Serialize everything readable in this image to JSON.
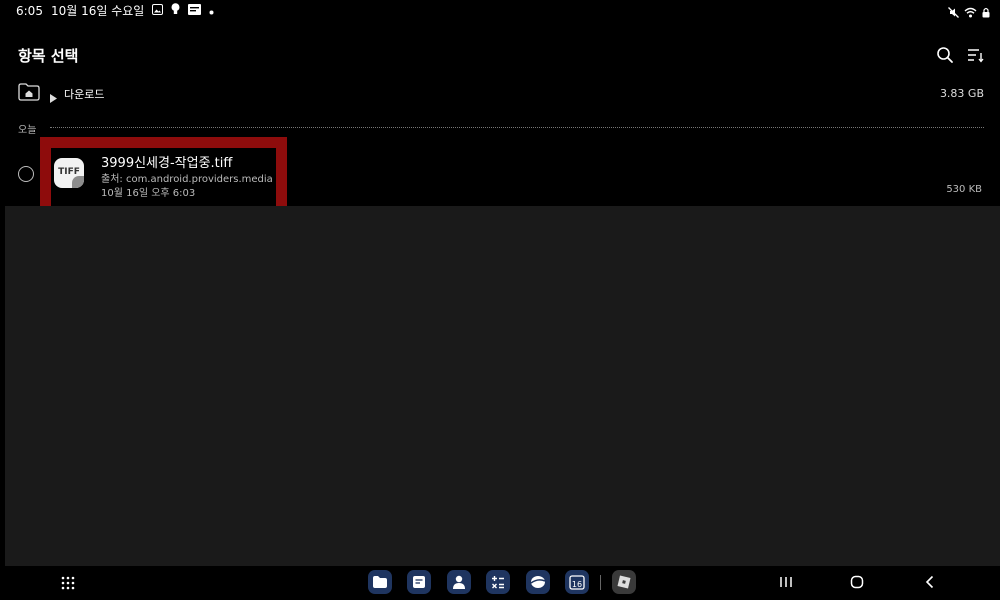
{
  "status_bar": {
    "time": "6:05",
    "date": "10월 16일 수요일",
    "icons_left": [
      "image-icon",
      "bulb-icon",
      "screenshot-icon",
      "dot-icon"
    ],
    "icons_right": [
      "mute-icon",
      "wifi-icon",
      "lock-icon"
    ]
  },
  "header": {
    "title": "항목 선택",
    "actions": [
      "search-icon",
      "sort-icon"
    ]
  },
  "breadcrumb": {
    "folder": "다운로드",
    "storage_size": "3.83 GB"
  },
  "section": {
    "label": "오늘"
  },
  "files": [
    {
      "type_label": "TIFF",
      "name": "3999신세경-작업중.tiff",
      "source": "출처: com.android.providers.media",
      "date": "10월 16일 오후 6:03",
      "size": "530 KB",
      "selected": false
    }
  ],
  "colors": {
    "background": "#000000",
    "empty_area": "#1a1a1a",
    "highlight": "#8e0c0c",
    "dock_app": "#1f3560"
  },
  "nav_bar": {
    "dock_apps": [
      "files-icon",
      "notes-icon",
      "contacts-icon",
      "calculator-icon",
      "internet-icon",
      "calendar-icon",
      "roblox-icon"
    ],
    "calendar_day": "16",
    "system_buttons": [
      "recents-icon",
      "home-icon",
      "back-icon"
    ]
  }
}
